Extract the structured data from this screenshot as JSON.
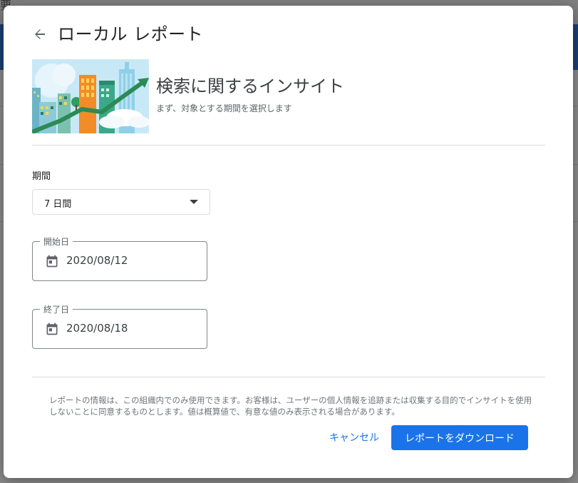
{
  "background": {
    "corner_glyph": "要"
  },
  "dialog": {
    "title": "ローカル レポート",
    "back_icon": "arrow-left-icon",
    "hero": {
      "title": "検索に関するインサイト",
      "subtitle": "まず、対象とする期間を選択します"
    },
    "period": {
      "label": "期間",
      "selected": "7 日間"
    },
    "start_date": {
      "label": "開始日",
      "value": "2020/08/12",
      "icon": "calendar-icon"
    },
    "end_date": {
      "label": "終了日",
      "value": "2020/08/18",
      "icon": "calendar-icon"
    },
    "disclaimer": "レポートの情報は、この組織内でのみ使用できます。お客様は、ユーザーの個人情報を追跡または収集する目的でインサイトを使用しないことに同意するものとします。値は概算値で、有意な値のみ表示される場合があります。",
    "buttons": {
      "cancel": "キャンセル",
      "download": "レポートをダウンロード"
    }
  },
  "colors": {
    "primary": "#1a73e8",
    "backdrop": "#8a8a8a",
    "title_text": "#202124"
  }
}
